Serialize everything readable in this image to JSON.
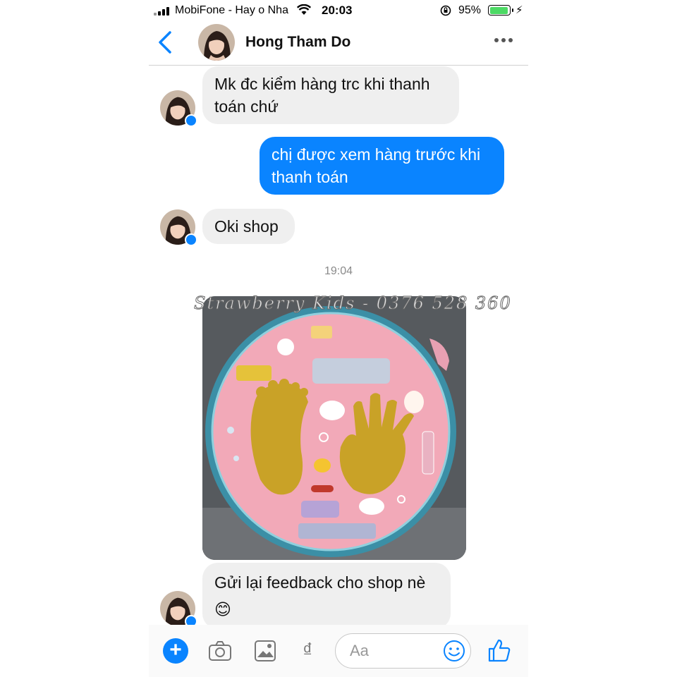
{
  "status_bar": {
    "carrier": "MobiFone - Hay o Nha",
    "time": "20:03",
    "battery_percent": "95%",
    "battery_level": 0.95
  },
  "header": {
    "contact_name": "Hong Tham Do",
    "back_icon": "chevron-left-icon",
    "more_icon": "more-dots-icon"
  },
  "messages": [
    {
      "from": "contact",
      "lines": [
        "Mk đc kiểm hàng trc khi thanh",
        "toán chứ"
      ]
    },
    {
      "from": "me",
      "lines": [
        "chị được xem hàng trước khi",
        "thanh toán"
      ]
    },
    {
      "from": "contact",
      "lines": [
        "Oki shop"
      ]
    },
    {
      "from": "contact",
      "type": "photo",
      "watermark": "Strawberry Kids - 0376 528 360"
    },
    {
      "from": "contact",
      "lines": [
        "Gửi lại feedback cho shop nè",
        "😊"
      ]
    }
  ],
  "timestamp": "19:04",
  "composer": {
    "placeholder": "Aa",
    "currency_symbol": "₫",
    "icons": [
      "plus-icon",
      "camera-icon",
      "gallery-icon",
      "emoji-icon",
      "like-icon"
    ]
  },
  "colors": {
    "accent": "#0a84ff",
    "incoming_bubble": "#efefef",
    "battery_green": "#4cd964"
  }
}
